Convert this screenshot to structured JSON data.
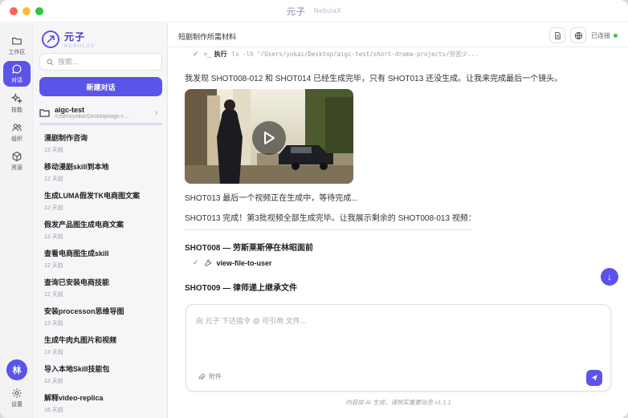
{
  "window": {
    "title": "元子",
    "subtitle": "NebulaX"
  },
  "rail": {
    "items": [
      {
        "label": "工作区",
        "icon": "folder-icon"
      },
      {
        "label": "对话",
        "icon": "chat-icon",
        "active": true
      },
      {
        "label": "技能",
        "icon": "sparkle-icon"
      },
      {
        "label": "组织",
        "icon": "users-icon"
      },
      {
        "label": "资源",
        "icon": "cube-icon"
      }
    ],
    "avatar": "林",
    "settings_label": "设置"
  },
  "sidebar": {
    "brand_name": "元子",
    "brand_sub": "NEBULAX",
    "search_placeholder": "搜索...",
    "new_chat_label": "新建对话",
    "project": {
      "name": "aigc-test",
      "path": "/Users/yokai/Desktop/aigc-t…"
    },
    "conversations": [
      {
        "title": "漫剧制作咨询",
        "time": "12 天前"
      },
      {
        "title": "移动漫剧skill到本地",
        "time": "12 天前"
      },
      {
        "title": "生成LUMA假发TK电商图文案",
        "time": "12 天前"
      },
      {
        "title": "假发产品图生成电商文案",
        "time": "12 天前"
      },
      {
        "title": "查看电商图生成skill",
        "time": "12 天前"
      },
      {
        "title": "查询已安装电商技能",
        "time": "12 天前"
      },
      {
        "title": "安装processon思维导图",
        "time": "13 天前"
      },
      {
        "title": "生成牛肉丸图片和视频",
        "time": "13 天前"
      },
      {
        "title": "导入本地Skill技能包",
        "time": "13 天前"
      },
      {
        "title": "解释video-replica",
        "time": "16 天前"
      }
    ]
  },
  "main": {
    "title": "短剧制作所需材料",
    "status": "已连接",
    "exec": {
      "label": "执行",
      "prompt": ">_",
      "command": "ls -lh \"/Users/yokai/Desktop/aigc-test/short-drama-projects/穷苦少..."
    },
    "messages": {
      "m1": "我发现 SHOT008-012 和 SHOT014 已经生成完毕，只有 SHOT013 还没生成。让我来完成最后一个镜头。",
      "m2": "SHOT013 最后一个视频正在生成中，等待完成...",
      "m3": "SHOT013 完成！第3批视频全部生成完毕。让我展示剩余的 SHOT008-013 视频："
    },
    "shot8_title": "SHOT008 — 劳斯莱斯停在林昭面前",
    "tool_name": "view-file-to-user",
    "shot9_title": "SHOT009 — 律师递上继承文件",
    "composer_placeholder": "向 元子 下达指令 @ 可引用 文件...",
    "attach_label": "附件",
    "footer": "内容由 AI 生成，请核实重要信息 v1.1.1"
  },
  "colors": {
    "accent": "#5b54e8",
    "connected": "#34c759",
    "check": "#2fa84f"
  }
}
